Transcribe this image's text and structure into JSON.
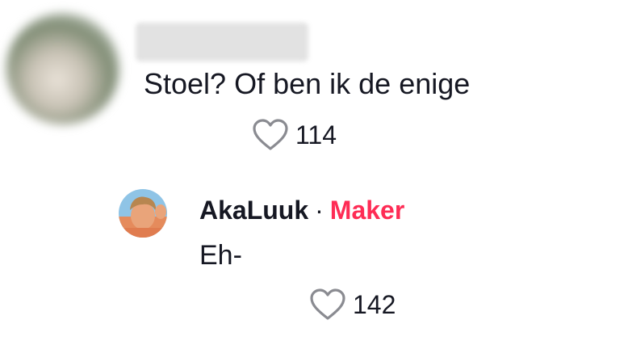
{
  "top_comment": {
    "text": "Stoel? Of ben ik de enige",
    "likes": "114",
    "like_icon": "heart-outline-icon"
  },
  "reply": {
    "author": "AkaLuuk",
    "separator": "·",
    "badge": "Maker",
    "text": "Eh-",
    "likes": "142",
    "like_icon": "heart-outline-icon"
  },
  "colors": {
    "text": "#161823",
    "badge": "#fe2c55",
    "icon": "#8a8b91"
  }
}
